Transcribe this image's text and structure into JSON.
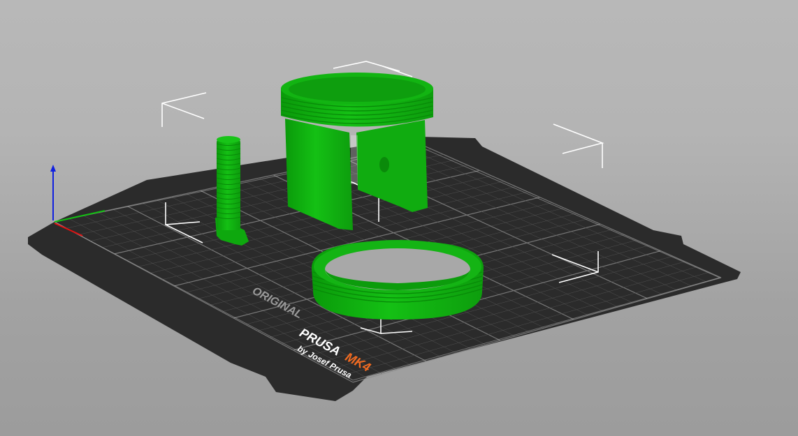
{
  "app": {
    "view": "3D plater view"
  },
  "bed": {
    "brand_prefix": "ORIGINAL",
    "brand_name": "PRUSA",
    "model": "MK4",
    "byline": "by Josef Prusa",
    "colors": {
      "sheet": "#2b2b2b",
      "grid": "#4a4a4a",
      "label": "#ffffff",
      "accent": "#f26b21"
    }
  },
  "objects": [
    {
      "name": "threaded-rod",
      "color": "#11b411"
    },
    {
      "name": "cylindrical-holder",
      "color": "#11b411"
    },
    {
      "name": "threaded-ring",
      "color": "#11b411"
    }
  ],
  "axes": {
    "x_color": "#e01010",
    "y_color": "#10c010",
    "z_color": "#1020e0"
  },
  "icons": [
    "selection-bracket-icon",
    "axis-triad-icon"
  ]
}
